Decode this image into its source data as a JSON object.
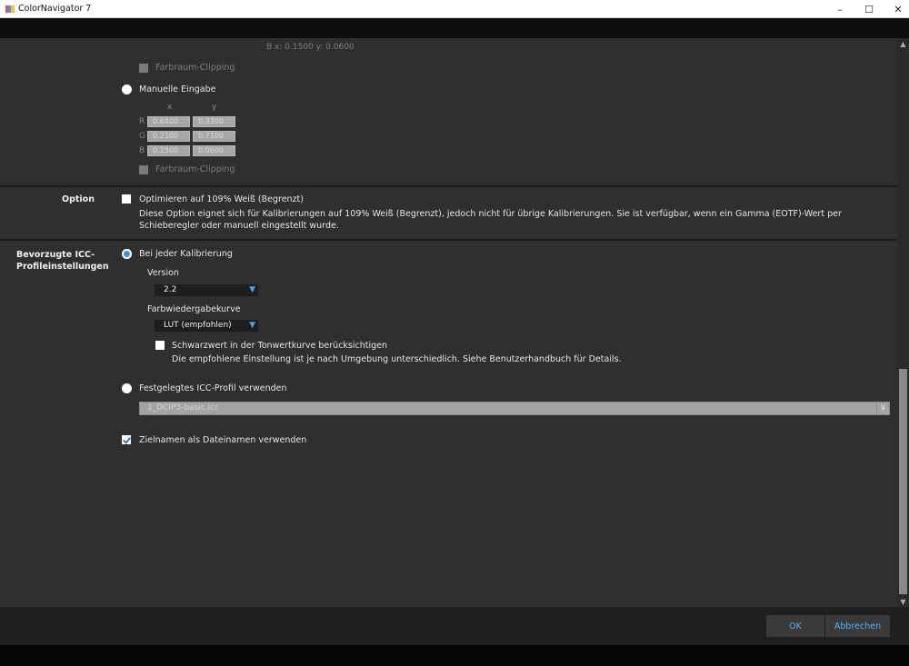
{
  "window": {
    "title": "ColorNavigator 7",
    "minimize": "–",
    "maximize": "☐",
    "close": "✕"
  },
  "gamut": {
    "top_readout": "B x: 0.1500   y: 0.0600",
    "clipping_label_1": "Farbraum-Clipping",
    "manual_label": "Manuelle Eingabe",
    "col_x": "x",
    "col_y": "y",
    "rows": [
      {
        "label": "R",
        "x": "0.6400",
        "y": "0.3300"
      },
      {
        "label": "G",
        "x": "0.2100",
        "y": "0.7100"
      },
      {
        "label": "B",
        "x": "0.1500",
        "y": "0.0600"
      }
    ],
    "clipping_label_2": "Farbraum-Clipping"
  },
  "option": {
    "section_label": "Option",
    "checkbox_label": "Optimieren auf 109% Weiß (Begrenzt)",
    "description": "Diese Option eignet sich für Kalibrierungen auf 109% Weiß (Begrenzt), jedoch nicht für übrige Kalibrierungen. Sie ist verfügbar, wenn ein Gamma (EOTF)-Wert per Schieberegler oder manuell eingestellt wurde."
  },
  "icc": {
    "section_label_line1": "Bevorzugte ICC-",
    "section_label_line2": "Profileinstellungen",
    "each_calibration_label": "Bei jeder Kalibrierung",
    "version_label": "Version",
    "version_value": "2.2",
    "curve_label": "Farbwiedergabekurve",
    "curve_value": "LUT (empfohlen)",
    "black_label": "Schwarzwert in der Tonwertkurve berücksichtigen",
    "black_note": "Die empfohlene Einstellung ist je nach Umgebung unterschiedlich. Siehe Benutzerhandbuch für Details.",
    "fixed_label": "Festgelegtes ICC-Profil verwenden",
    "fixed_value": "1_DCIP3-basic.icc",
    "target_name_label": "Zielnamen als Dateinamen verwenden"
  },
  "footer": {
    "ok": "OK",
    "cancel": "Abbrechen"
  }
}
